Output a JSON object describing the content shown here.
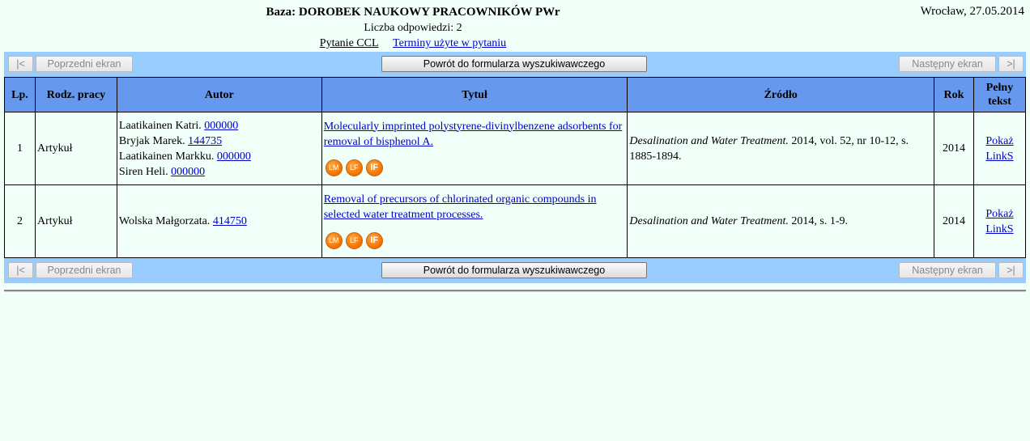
{
  "header": {
    "title": "Baza: DOROBEK NAUKOWY PRACOWNIKÓW PWr",
    "count": "Liczba odpowiedzi: 2",
    "ccl_link": "Pytanie CCL",
    "terms_link": "Terminy użyte w pytaniu",
    "date": "Wrocław, 27.05.2014"
  },
  "nav": {
    "first": "|<",
    "prev": "Poprzedni ekran",
    "back": "Powrót do formularza wyszukiwawczego",
    "next": "Następny ekran",
    "last": ">|"
  },
  "table": {
    "headers": {
      "lp": "Lp.",
      "rodz": "Rodz. pracy",
      "autor": "Autor",
      "tytul": "Tytuł",
      "zrodlo": "Źródło",
      "rok": "Rok",
      "pelny": "Pełny tekst"
    },
    "rows": [
      {
        "lp": "1",
        "rodz": "Artykuł",
        "authors": [
          {
            "name": "Laatikainen Katri.",
            "id": "000000"
          },
          {
            "name": "Bryjak Marek.",
            "id": "144735"
          },
          {
            "name": "Laatikainen Markku.",
            "id": "000000"
          },
          {
            "name": "Siren Heli.",
            "id": "000000"
          }
        ],
        "title": "Molecularly imprinted polystyrene-divinylbenzene adsorbents for removal of bisphenol A.",
        "icons": {
          "lm": "LM",
          "lf": "LF",
          "if": "IF"
        },
        "source_journal": "Desalination and Water Treatment.",
        "source_rest": " 2014, vol. 52, nr 10-12, s. 1885-1894.",
        "rok": "2014",
        "link1": "Pokaż",
        "link2": "LinkS"
      },
      {
        "lp": "2",
        "rodz": "Artykuł",
        "authors": [
          {
            "name": "Wolska Małgorzata.",
            "id": "414750"
          }
        ],
        "title": "Removal of precursors of chlorinated organic compounds in selected water treatment processes.",
        "icons": {
          "lm": "LM",
          "lf": "LF",
          "if": "IF"
        },
        "source_journal": "Desalination and Water Treatment.",
        "source_rest": " 2014, s. 1-9.",
        "rok": "2014",
        "link1": "Pokaż",
        "link2": "LinkS"
      }
    ]
  }
}
